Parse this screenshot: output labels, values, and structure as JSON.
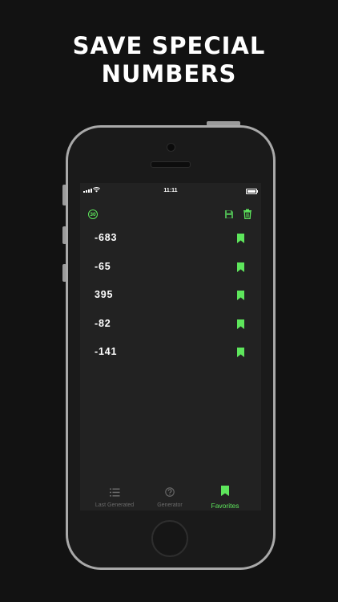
{
  "headline": {
    "line1": "SAVE SPECIAL",
    "line2": "NUMBERS"
  },
  "status_bar": {
    "time": "11:11"
  },
  "toolbar": {
    "counter_value": "30",
    "counter_icon": "counter-30-icon",
    "save_icon": "floppy-disk-icon",
    "delete_icon": "trash-icon"
  },
  "favorites": [
    {
      "value": "-683"
    },
    {
      "value": "-65"
    },
    {
      "value": "395"
    },
    {
      "value": "-82"
    },
    {
      "value": "-141"
    }
  ],
  "tab_bar": {
    "tabs": [
      {
        "label": "Last Generated",
        "icon": "list-icon",
        "active": false
      },
      {
        "label": "Generator",
        "icon": "question-circle-icon",
        "active": false
      },
      {
        "label": "Favorites",
        "icon": "bookmark-icon",
        "active": true
      }
    ]
  },
  "colors": {
    "accent": "#5ee65c",
    "background": "#121212",
    "screen": "#222222",
    "inactive": "#6b6b6b"
  }
}
